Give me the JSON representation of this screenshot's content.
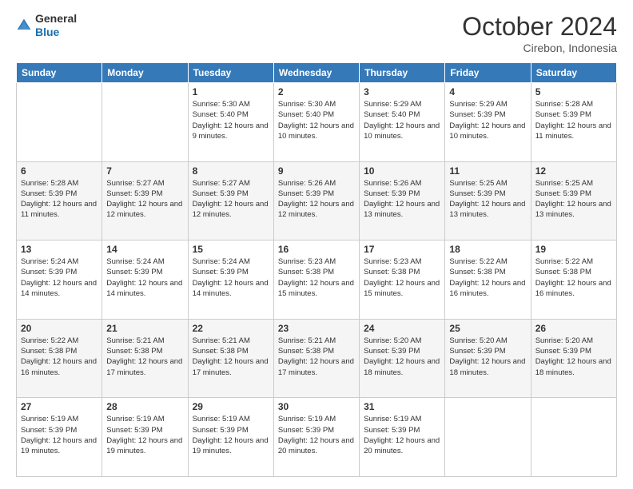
{
  "header": {
    "logo": {
      "line1": "General",
      "line2": "Blue"
    },
    "title": "October 2024",
    "subtitle": "Cirebon, Indonesia"
  },
  "days_of_week": [
    "Sunday",
    "Monday",
    "Tuesday",
    "Wednesday",
    "Thursday",
    "Friday",
    "Saturday"
  ],
  "weeks": [
    [
      {
        "day": "",
        "info": ""
      },
      {
        "day": "",
        "info": ""
      },
      {
        "day": "1",
        "info": "Sunrise: 5:30 AM\nSunset: 5:40 PM\nDaylight: 12 hours and 9 minutes."
      },
      {
        "day": "2",
        "info": "Sunrise: 5:30 AM\nSunset: 5:40 PM\nDaylight: 12 hours and 10 minutes."
      },
      {
        "day": "3",
        "info": "Sunrise: 5:29 AM\nSunset: 5:40 PM\nDaylight: 12 hours and 10 minutes."
      },
      {
        "day": "4",
        "info": "Sunrise: 5:29 AM\nSunset: 5:39 PM\nDaylight: 12 hours and 10 minutes."
      },
      {
        "day": "5",
        "info": "Sunrise: 5:28 AM\nSunset: 5:39 PM\nDaylight: 12 hours and 11 minutes."
      }
    ],
    [
      {
        "day": "6",
        "info": "Sunrise: 5:28 AM\nSunset: 5:39 PM\nDaylight: 12 hours and 11 minutes."
      },
      {
        "day": "7",
        "info": "Sunrise: 5:27 AM\nSunset: 5:39 PM\nDaylight: 12 hours and 12 minutes."
      },
      {
        "day": "8",
        "info": "Sunrise: 5:27 AM\nSunset: 5:39 PM\nDaylight: 12 hours and 12 minutes."
      },
      {
        "day": "9",
        "info": "Sunrise: 5:26 AM\nSunset: 5:39 PM\nDaylight: 12 hours and 12 minutes."
      },
      {
        "day": "10",
        "info": "Sunrise: 5:26 AM\nSunset: 5:39 PM\nDaylight: 12 hours and 13 minutes."
      },
      {
        "day": "11",
        "info": "Sunrise: 5:25 AM\nSunset: 5:39 PM\nDaylight: 12 hours and 13 minutes."
      },
      {
        "day": "12",
        "info": "Sunrise: 5:25 AM\nSunset: 5:39 PM\nDaylight: 12 hours and 13 minutes."
      }
    ],
    [
      {
        "day": "13",
        "info": "Sunrise: 5:24 AM\nSunset: 5:39 PM\nDaylight: 12 hours and 14 minutes."
      },
      {
        "day": "14",
        "info": "Sunrise: 5:24 AM\nSunset: 5:39 PM\nDaylight: 12 hours and 14 minutes."
      },
      {
        "day": "15",
        "info": "Sunrise: 5:24 AM\nSunset: 5:39 PM\nDaylight: 12 hours and 14 minutes."
      },
      {
        "day": "16",
        "info": "Sunrise: 5:23 AM\nSunset: 5:38 PM\nDaylight: 12 hours and 15 minutes."
      },
      {
        "day": "17",
        "info": "Sunrise: 5:23 AM\nSunset: 5:38 PM\nDaylight: 12 hours and 15 minutes."
      },
      {
        "day": "18",
        "info": "Sunrise: 5:22 AM\nSunset: 5:38 PM\nDaylight: 12 hours and 16 minutes."
      },
      {
        "day": "19",
        "info": "Sunrise: 5:22 AM\nSunset: 5:38 PM\nDaylight: 12 hours and 16 minutes."
      }
    ],
    [
      {
        "day": "20",
        "info": "Sunrise: 5:22 AM\nSunset: 5:38 PM\nDaylight: 12 hours and 16 minutes."
      },
      {
        "day": "21",
        "info": "Sunrise: 5:21 AM\nSunset: 5:38 PM\nDaylight: 12 hours and 17 minutes."
      },
      {
        "day": "22",
        "info": "Sunrise: 5:21 AM\nSunset: 5:38 PM\nDaylight: 12 hours and 17 minutes."
      },
      {
        "day": "23",
        "info": "Sunrise: 5:21 AM\nSunset: 5:38 PM\nDaylight: 12 hours and 17 minutes."
      },
      {
        "day": "24",
        "info": "Sunrise: 5:20 AM\nSunset: 5:39 PM\nDaylight: 12 hours and 18 minutes."
      },
      {
        "day": "25",
        "info": "Sunrise: 5:20 AM\nSunset: 5:39 PM\nDaylight: 12 hours and 18 minutes."
      },
      {
        "day": "26",
        "info": "Sunrise: 5:20 AM\nSunset: 5:39 PM\nDaylight: 12 hours and 18 minutes."
      }
    ],
    [
      {
        "day": "27",
        "info": "Sunrise: 5:19 AM\nSunset: 5:39 PM\nDaylight: 12 hours and 19 minutes."
      },
      {
        "day": "28",
        "info": "Sunrise: 5:19 AM\nSunset: 5:39 PM\nDaylight: 12 hours and 19 minutes."
      },
      {
        "day": "29",
        "info": "Sunrise: 5:19 AM\nSunset: 5:39 PM\nDaylight: 12 hours and 19 minutes."
      },
      {
        "day": "30",
        "info": "Sunrise: 5:19 AM\nSunset: 5:39 PM\nDaylight: 12 hours and 20 minutes."
      },
      {
        "day": "31",
        "info": "Sunrise: 5:19 AM\nSunset: 5:39 PM\nDaylight: 12 hours and 20 minutes."
      },
      {
        "day": "",
        "info": ""
      },
      {
        "day": "",
        "info": ""
      }
    ]
  ]
}
